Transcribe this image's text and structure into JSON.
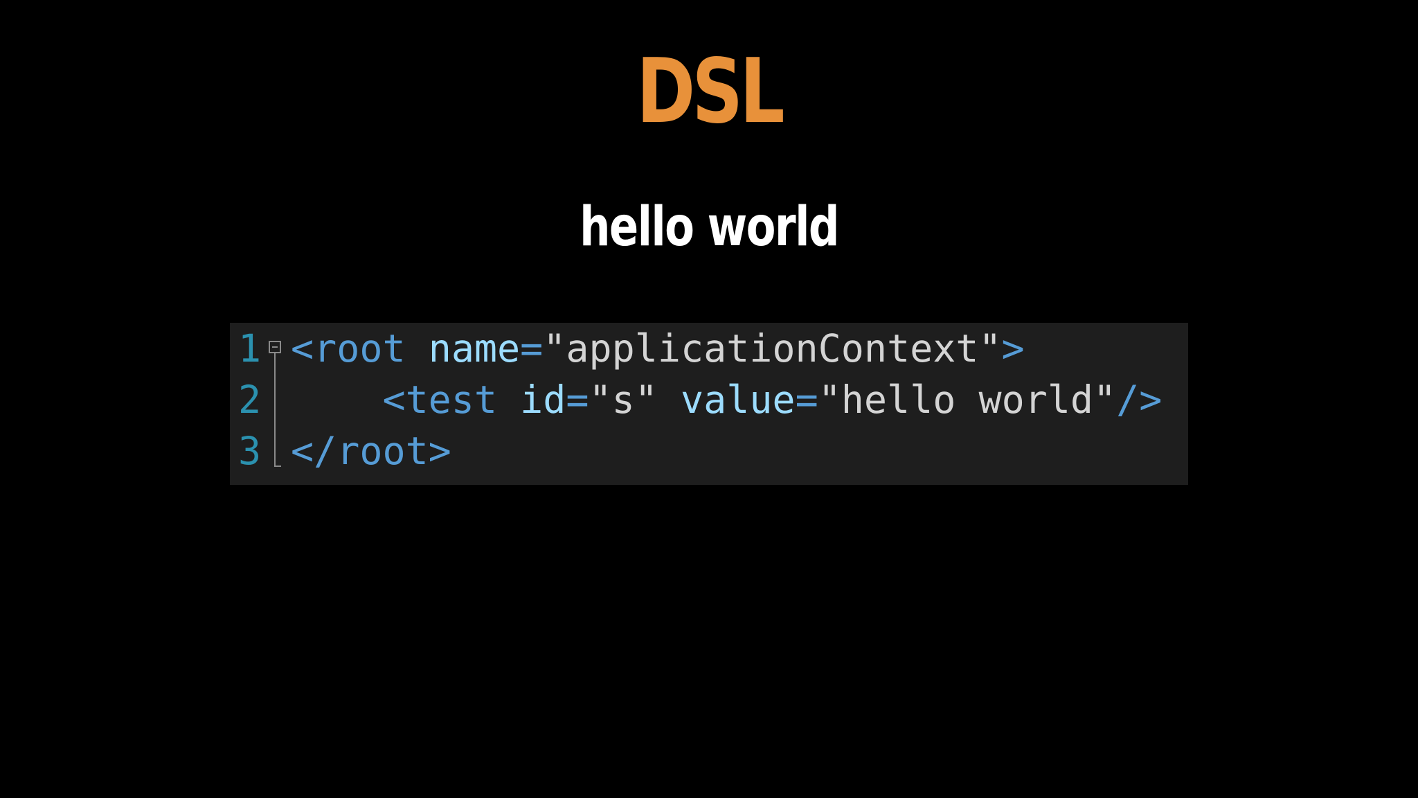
{
  "title": "DSL",
  "subtitle": "hello world",
  "colors": {
    "background": "#000000",
    "title": "#e8913a",
    "subtitle": "#ffffff",
    "code_background": "#1e1e1e",
    "line_number": "#2b91af",
    "tag": "#569cd6",
    "attribute": "#9cdcfe",
    "value": "#d4d4d4",
    "fold_marker": "#8a8a8a"
  },
  "code": {
    "language": "xml",
    "lines": [
      {
        "number": "1",
        "tokens": [
          {
            "text": "<root",
            "kind": "tag"
          },
          {
            "text": " ",
            "kind": "value"
          },
          {
            "text": "name",
            "kind": "attribute"
          },
          {
            "text": "=",
            "kind": "tag"
          },
          {
            "text": "\"applicationContext\"",
            "kind": "value"
          },
          {
            "text": ">",
            "kind": "tag"
          }
        ]
      },
      {
        "number": "2",
        "tokens": [
          {
            "text": "    ",
            "kind": "value"
          },
          {
            "text": "<test",
            "kind": "tag"
          },
          {
            "text": " ",
            "kind": "value"
          },
          {
            "text": "id",
            "kind": "attribute"
          },
          {
            "text": "=",
            "kind": "tag"
          },
          {
            "text": "\"s\"",
            "kind": "value"
          },
          {
            "text": " ",
            "kind": "value"
          },
          {
            "text": "value",
            "kind": "attribute"
          },
          {
            "text": "=",
            "kind": "tag"
          },
          {
            "text": "\"hello world\"",
            "kind": "value"
          },
          {
            "text": "/>",
            "kind": "tag"
          }
        ]
      },
      {
        "number": "3",
        "tokens": [
          {
            "text": "</root>",
            "kind": "tag"
          }
        ]
      }
    ]
  }
}
